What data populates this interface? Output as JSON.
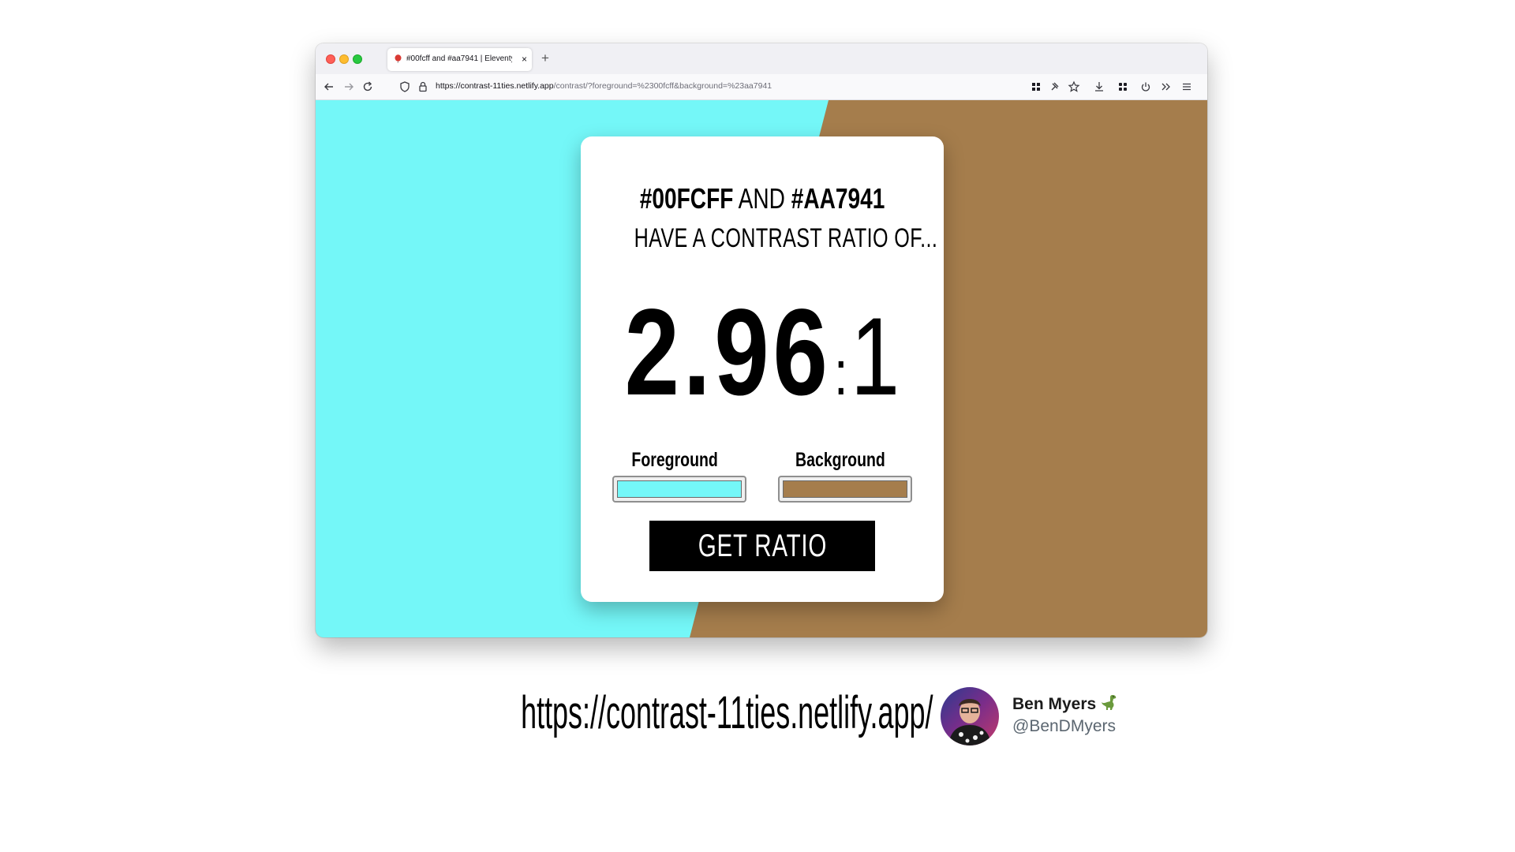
{
  "browser": {
    "tab_title": "#00fcff and #aa7941 | Eleventy",
    "tab_close": "×",
    "new_tab": "+",
    "url_host": "https://contrast-11ties.netlify.app",
    "url_path": "/contrast/?foreground=%2300fcff&background=%23aa7941"
  },
  "colors": {
    "foreground": "#00fcff",
    "background": "#aa7941",
    "page_left": "#74f7f8",
    "page_right": "#a57d4c"
  },
  "card": {
    "fg_hex": "#00FCFF",
    "and_word": "AND",
    "bg_hex": "#AA7941",
    "subtitle": "HAVE A CONTRAST RATIO OF...",
    "ratio_value": "2.96",
    "ratio_sep": ":",
    "ratio_one": "1",
    "foreground_label": "Foreground",
    "background_label": "Background",
    "button_label": "GET RATIO"
  },
  "footer": {
    "url": "https://contrast-11ties.netlify.app/",
    "author_name": "Ben Myers",
    "author_handle": "@BenDMyers"
  },
  "icons": [
    "back-arrow-icon",
    "forward-arrow-icon",
    "reload-icon",
    "shield-icon",
    "lock-icon",
    "extension-grid-icon",
    "pin-icon",
    "star-icon",
    "download-icon",
    "apps-icon",
    "power-icon",
    "overflow-chevrons-icon",
    "menu-icon",
    "dinosaur-icon"
  ]
}
